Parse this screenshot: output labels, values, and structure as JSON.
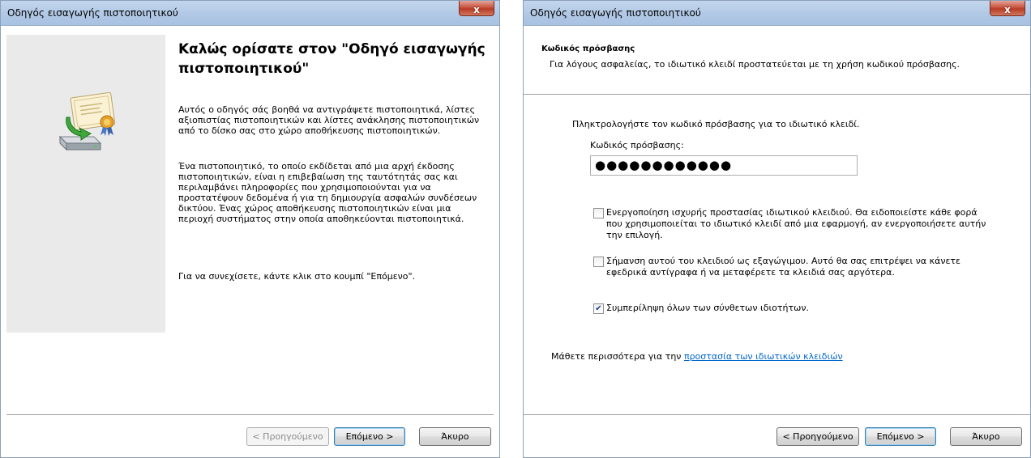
{
  "dialog1": {
    "title": "Οδηγός εισαγωγής πιστοποιητικού",
    "close_glyph": "x",
    "sidebar_icon": "certificate-install-icon",
    "heading": "Καλώς ορίσατε στον \"Οδηγό εισαγωγής πιστοποιητικού\"",
    "paragraphs": [
      "Αυτός ο οδηγός σάς βοηθά να αντιγράψετε πιστοποιητικά, λίστες αξιοπιστίας πιστοποιητικών και λίστες ανάκλησης πιστοποιητικών από το δίσκο σας στο χώρο αποθήκευσης πιστοποιητικών.",
      "Ένα πιστοποιητικό, το οποίο εκδίδεται από μια αρχή έκδοσης πιστοποιητικών, είναι η επιβεβαίωση της ταυτότητάς σας και περιλαμβάνει πληροφορίες που χρησιμοποιούνται για να προστατέψουν δεδομένα ή για τη δημιουργία ασφαλών συνδέσεων δικτύου. Ένας χώρος αποθήκευσης πιστοποιητικών είναι μια περιοχή συστήματος στην οποία αποθηκεύονται πιστοποιητικά.",
      "Για να συνεχίσετε, κάντε κλικ στο κουμπί \"Επόμενο\"."
    ],
    "buttons": {
      "back": "< Προηγούμενο",
      "next": "Επόμενο >",
      "cancel": "Άκυρο"
    }
  },
  "dialog2": {
    "title": "Οδηγός εισαγωγής πιστοποιητικού",
    "close_glyph": "x",
    "header": {
      "title": "Κωδικός πρόσβασης",
      "description": "Για λόγους ασφαλείας, το ιδιωτικό κλειδί προστατεύεται με τη χρήση κωδικού πρόσβασης."
    },
    "prompt": "Πληκτρολογήστε τον κωδικό πρόσβασης για το ιδιωτικό κλειδί.",
    "password_label": "Κωδικός πρόσβασης:",
    "password_value": "●●●●●●●●●●●●",
    "options": [
      {
        "label": "Ενεργοποίηση ισχυρής προστασίας ιδιωτικού κλειδιού. Θα ειδοποιείστε κάθε φορά που χρησιμοποιείται το ιδιωτικό κλειδί από μια εφαρμογή, αν ενεργοποιήσετε αυτήν την επιλογή.",
        "checked": false,
        "mark": ""
      },
      {
        "label": "Σήμανση αυτού του κλειδιού ως εξαγώγιμου. Αυτό θα σας επιτρέψει να κάνετε εφεδρικά αντίγραφα ή να μεταφέρετε τα κλειδιά σας αργότερα.",
        "checked": false,
        "mark": ""
      },
      {
        "label": "Συμπερίληψη όλων των σύνθετων ιδιοτήτων.",
        "checked": true,
        "mark": "✔"
      }
    ],
    "learn_more_prefix": "Μάθετε περισσότερα για την ",
    "learn_more_link": "προστασία των ιδιωτικών κλειδιών",
    "buttons": {
      "back": "< Προηγούμενο",
      "next": "Επόμενο >",
      "cancel": "Άκυρο"
    }
  }
}
